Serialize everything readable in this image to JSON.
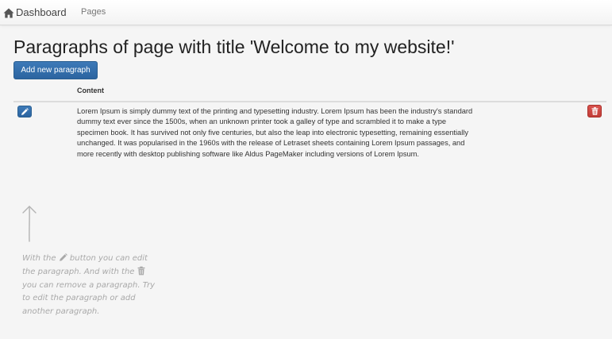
{
  "navbar": {
    "brand_label": "Dashboard",
    "brand_icon": "home-icon",
    "pages_label": "Pages"
  },
  "main": {
    "title": "Paragraphs of page with title 'Welcome to my website!'",
    "add_button_label": "Add new paragraph",
    "table": {
      "columns": [
        "",
        "Content",
        ""
      ],
      "rows": [
        {
          "content": "Lorem Ipsum is simply dummy text of the printing and typesetting industry. Lorem Ipsum has been the industry's standard dummy text ever since the 1500s, when an unknown printer took a galley of type and scrambled it to make a type specimen book. It has survived not only five centuries, but also the leap into electronic typesetting, remaining essentially unchanged. It was popularised in the 1960s with the release of Letraset sheets containing Lorem Ipsum passages, and more recently with desktop publishing software like Aldus PageMaker including versions of Lorem Ipsum.",
          "edit_icon": "pencil-icon",
          "delete_icon": "trash-icon"
        }
      ]
    }
  },
  "hint": {
    "part1": "With the ",
    "part2": " button you can edit the paragraph. And with the ",
    "part3": " you can remove a paragraph. Try to edit the paragraph or add another paragraph."
  },
  "colors": {
    "primary": "#337ab7",
    "danger": "#d9534f",
    "hint_text": "#a9a9a9",
    "background": "#f5f5f5"
  }
}
